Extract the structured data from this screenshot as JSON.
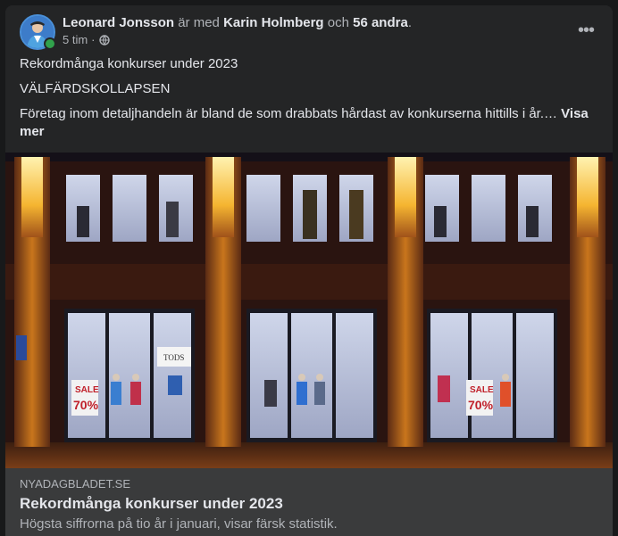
{
  "post": {
    "author": "Leonard Jonsson",
    "with_text": "är med",
    "tagged_person": "Karin Holmberg",
    "and_text": "och",
    "others": "56 andra",
    "period": ".",
    "timestamp": "5 tim",
    "separator": "·",
    "privacy_icon": "globe-icon",
    "more_icon": "more-options-icon",
    "more_glyph": "•••",
    "line1": "Rekordmånga konkurser under 2023",
    "line2": "VÄLFÄRDSKOLLAPSEN",
    "line3": "Företag inom detaljhandeln är bland de som drabbats hårdast av konkurserna hittills i år.… ",
    "see_more": "Visa mer"
  },
  "photo": {
    "sign_text_1": "SALE",
    "sign_text_2": "70%",
    "sign_text_3": "SALE",
    "sign_text_4": "70%",
    "store_sign": "TODS"
  },
  "link_preview": {
    "domain": "NYADAGBLADET.SE",
    "title": "Rekordmånga konkurser under 2023",
    "description": "Högsta siffrorna på tio år i januari, visar färsk statistik."
  },
  "colors": {
    "card_bg": "#242526",
    "preview_bg": "#3a3b3c",
    "primary_text": "#e4e6eb",
    "secondary_text": "#b0b3b8",
    "online": "#31a24c"
  }
}
